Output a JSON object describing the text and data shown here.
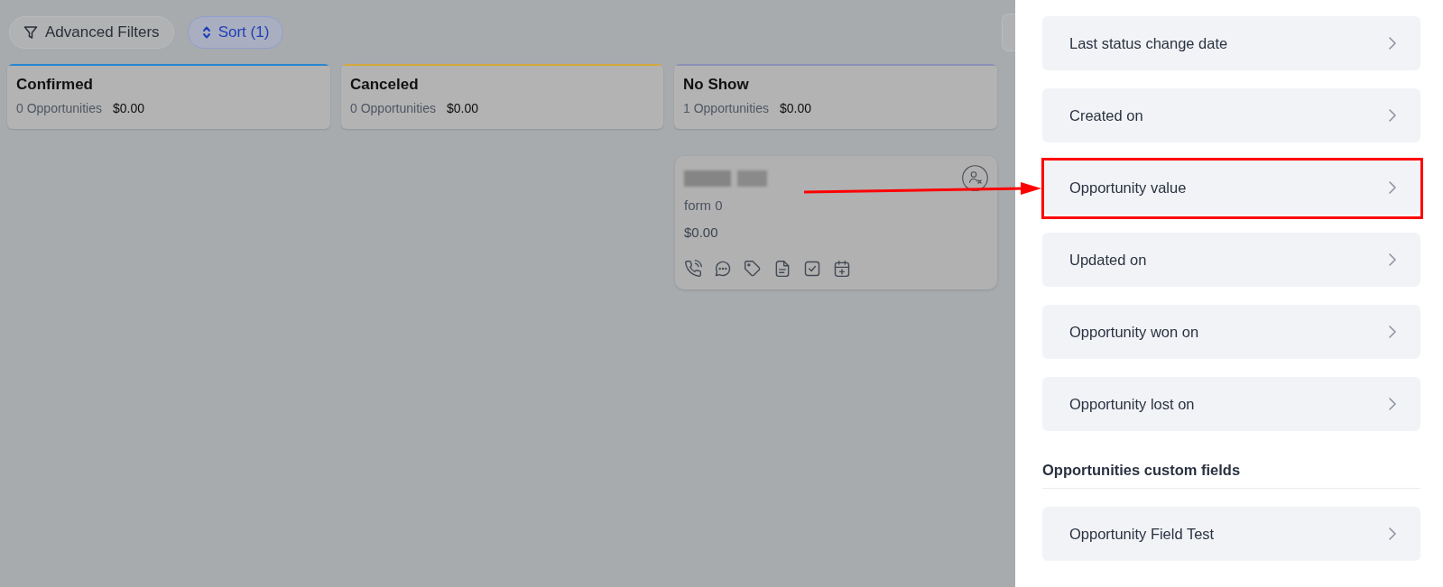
{
  "toolbar": {
    "buttons": [
      {
        "kind": "filter",
        "label": "Advanced Filters",
        "active": false
      },
      {
        "kind": "sort",
        "label": "Sort (1)",
        "active": true
      }
    ]
  },
  "columns": [
    {
      "title": "Confirmed",
      "count": "0 Opportunities",
      "total": "$0.00",
      "color": "#2a87d0"
    },
    {
      "title": "Canceled",
      "count": "0 Opportunities",
      "total": "$0.00",
      "color": "#d4a73a"
    },
    {
      "title": "No Show",
      "count": "1 Opportunities",
      "total": "$0.00",
      "color": "#8c8fb8",
      "cards": [
        {
          "source": "form 0",
          "value": "$0.00"
        }
      ]
    }
  ],
  "panel": {
    "groups": [
      {
        "items": [
          {
            "label": "Last status change date",
            "highlighted": false
          },
          {
            "label": "Created on",
            "highlighted": false
          },
          {
            "label": "Opportunity value",
            "highlighted": true
          },
          {
            "label": "Updated on",
            "highlighted": false
          },
          {
            "label": "Opportunity won on",
            "highlighted": false
          },
          {
            "label": "Opportunity lost on",
            "highlighted": false
          }
        ]
      },
      {
        "title": "Opportunities custom fields",
        "items": [
          {
            "label": "Opportunity Field Test",
            "highlighted": false
          }
        ]
      }
    ]
  }
}
